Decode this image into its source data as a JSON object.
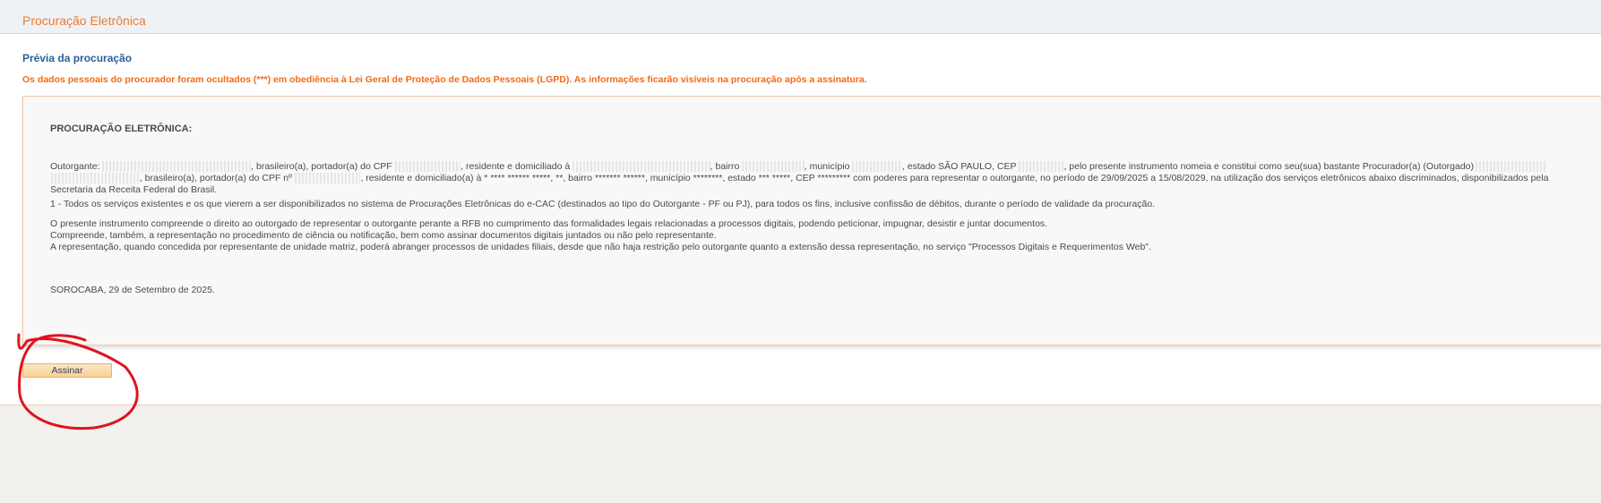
{
  "header": {
    "title": "Procuração Eletrônica"
  },
  "main": {
    "section_title": "Prévia da procuração",
    "lgpd_notice": "Os dados pessoais do procurador foram ocultados (***) em obediência à Lei Geral de Proteção de Dados Pessoais (LGPD). As informações ficarão visíveis na procuração após a assinatura.",
    "document": {
      "heading": "PROCURAÇÃO ELETRÔNICA:",
      "outorgante": {
        "p1": "Outorgante: ",
        "p2": ", brasileiro(a), portador(a) do CPF ",
        "p3": ", residente e domiciliado à ",
        "p4": ", bairro ",
        "p5": ", município ",
        "p6": ", estado SÃO PAULO, CEP ",
        "p7": ", pelo presente instrumento nomeia e constitui como seu(sua) bastante Procurador(a) (Outorgado) ",
        "p8": ", brasileiro(a), portador(a) do CPF nº ",
        "p9": ", residente e domiciliado(a) à * **** ****** *****, **, bairro ******* ******, município ********, estado *** *****, CEP ********* com poderes para representar o outorgante, no período de 29/09/2025 a 15/08/2029, na utilização dos serviços eletrônicos abaixo discriminados, disponibilizados pela Secretaria da Receita Federal do Brasil."
      },
      "item_1": "1 - Todos os serviços existentes e os que vierem a ser disponibilizados no sistema de Procurações Eletrônicas do e-CAC (destinados ao tipo do Outorgante - PF ou PJ), para todos os fins, inclusive confissão de débitos, durante o período de validade da procuração.",
      "paragraph_1": "O presente instrumento compreende o direito ao outorgado de representar o outorgante perante a RFB no cumprimento das formalidades legais relacionadas a processos digitais, podendo peticionar, impugnar, desistir e juntar documentos.",
      "paragraph_2": "Compreende, também, a representação no procedimento de ciência ou notificação, bem como assinar documentos digitais juntados ou não pelo representante.",
      "paragraph_3": "A representação, quando concedida por representante de unidade matriz, poderá abranger processos de unidades filiais, desde que não haja restrição pelo outorgante quanto a extensão dessa representação, no serviço \"Processos Digitais e Requerimentos Web\".",
      "place_date": "SOROCABA, 29 de Setembro de 2025."
    },
    "sign_button": "Assinar"
  },
  "colors": {
    "title_orange": "#f07a2a",
    "notice_orange": "#f06a1a",
    "section_blue": "#2b5e9a",
    "annotation_red": "#e0141e"
  }
}
